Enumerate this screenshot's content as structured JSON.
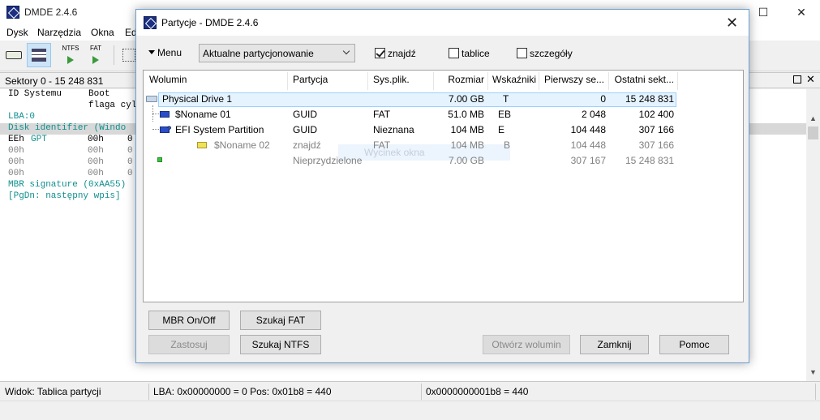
{
  "main": {
    "title": "DMDE 2.4.6",
    "menu": [
      "Dysk",
      "Narzędzia",
      "Okna",
      "Ed"
    ],
    "toolbar": {
      "ntfs_label": "NTFS",
      "fat_label": "FAT"
    },
    "sector_range": "Sektory 0 - 15 248 831",
    "editor": {
      "header1": "ID Systemu     Boot     Po",
      "header2": "               flaga cyl/",
      "lba": "LBA:0",
      "disk_identifier": "Disk identifier (Windo",
      "entries": [
        {
          "id": "EEh",
          "sys": "GPT",
          "boot": "00h",
          "val": "0"
        },
        {
          "id": "00h",
          "sys": "",
          "boot": "00h",
          "val": "0"
        },
        {
          "id": "00h",
          "sys": "",
          "boot": "00h",
          "val": "0"
        },
        {
          "id": "00h",
          "sys": "",
          "boot": "00h",
          "val": "0"
        }
      ],
      "mbr_signature": "MBR signature (0xAA55)",
      "pgdn": "[PgDn: następny wpis]"
    },
    "status": {
      "view": "Widok: Tablica partycji",
      "lba": "LBA: 0x00000000 = 0  Pos: 0x01b8 = 440",
      "addr": "0x0000000001b8 = 440"
    }
  },
  "dialog": {
    "title": "Partycje - DMDE 2.4.6",
    "menu_label": "Menu",
    "mode_select": "Aktualne partycjonowanie",
    "checkboxes": [
      {
        "label": "znajdź",
        "checked": true
      },
      {
        "label": "tablice",
        "checked": false
      },
      {
        "label": "szczegóły",
        "checked": false
      }
    ],
    "columns": [
      "Wolumin",
      "Partycja",
      "Sys.plik.",
      "Rozmiar",
      "Wskaźniki",
      "Pierwszy se...",
      "Ostatni sekt..."
    ],
    "rows": [
      {
        "volume": "Physical Drive 1",
        "partition": "",
        "fs": "",
        "size": "7.00 GB",
        "flags": "T",
        "first": "0",
        "last": "15 248 831"
      },
      {
        "volume": "$Noname 01",
        "partition": "GUID",
        "fs": "FAT",
        "size": "51.0 MB",
        "flags": "EB",
        "first": "2 048",
        "last": "102 400"
      },
      {
        "volume": "EFI System Partition",
        "partition": "GUID",
        "fs": "Nieznana",
        "size": "104 MB",
        "flags": "E",
        "first": "104 448",
        "last": "307 166"
      },
      {
        "volume": "$Noname 02",
        "partition": "znajdź",
        "fs": "FAT",
        "size": "104 MB",
        "flags": "B",
        "first": "104 448",
        "last": "307 166"
      },
      {
        "volume": "",
        "partition": "Nieprzydzielone",
        "fs": "",
        "size": "7.00 GB",
        "flags": "",
        "first": "307 167",
        "last": "15 248 831"
      }
    ],
    "ghost_label": "Wycinek okna",
    "buttons": {
      "mbr": "MBR On/Off",
      "search_fat": "Szukaj FAT",
      "apply": "Zastosuj",
      "search_ntfs": "Szukaj NTFS",
      "open_volume": "Otwórz wolumin",
      "close": "Zamknij",
      "help": "Pomoc"
    }
  }
}
